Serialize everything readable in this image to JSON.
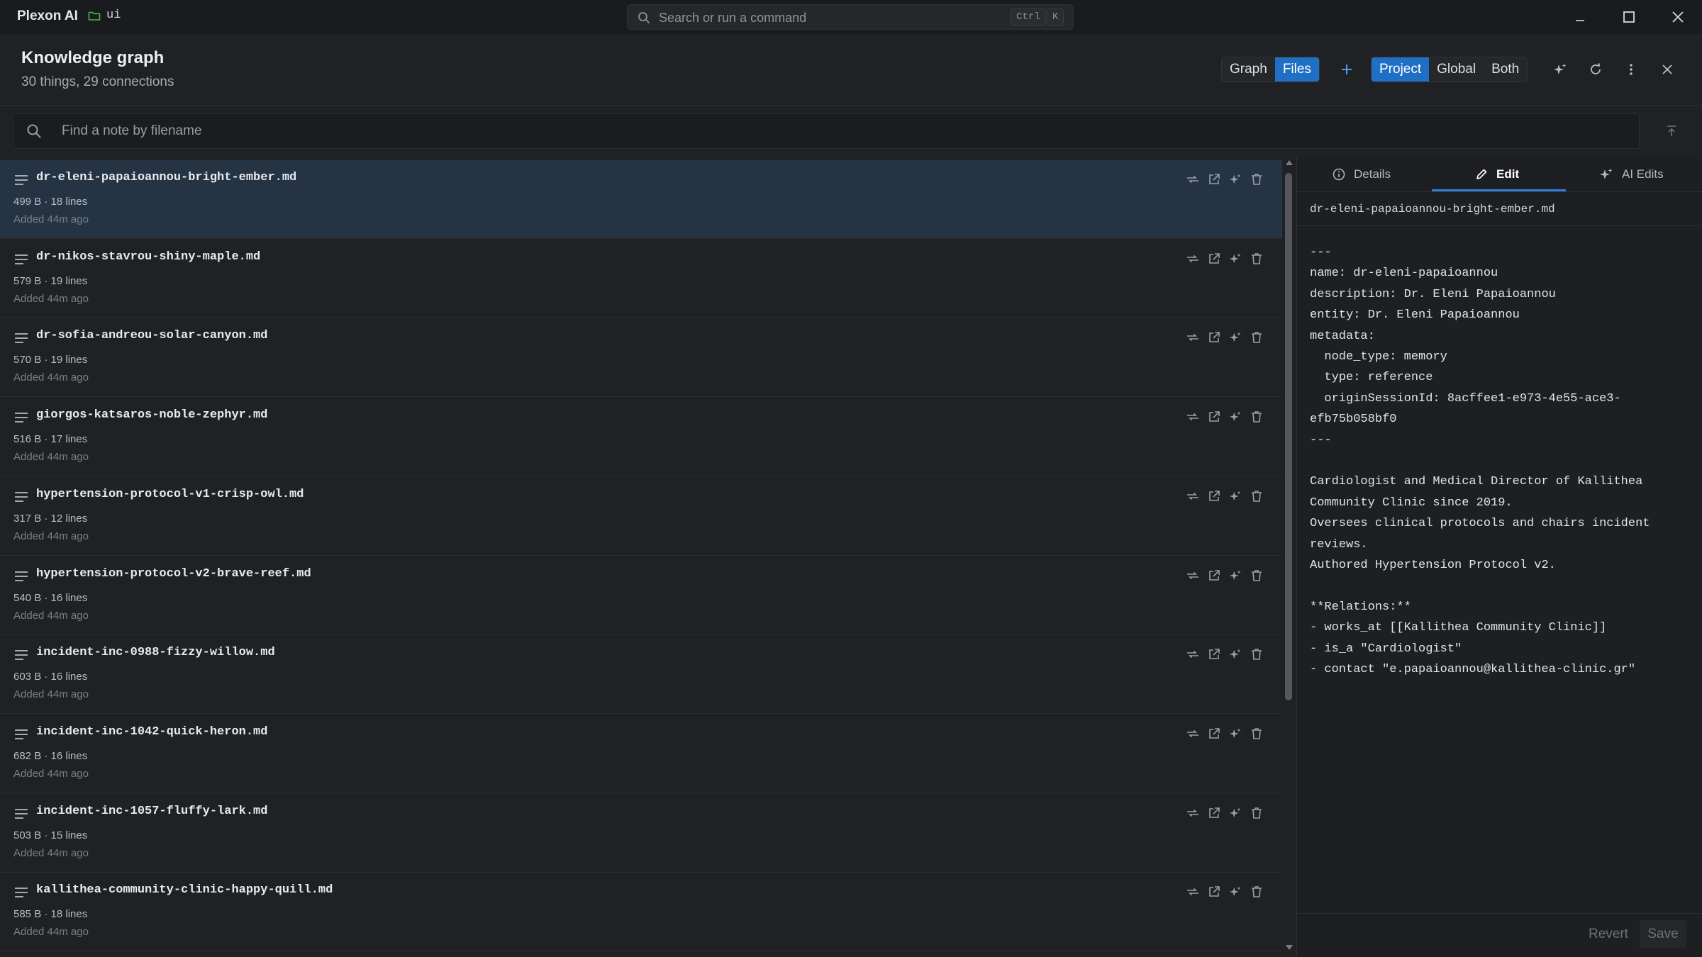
{
  "titlebar": {
    "app_name": "Plexon AI",
    "folder": "ui",
    "command_placeholder": "Search or run a command",
    "shortcut_ctrl": "Ctrl",
    "shortcut_key": "K"
  },
  "header": {
    "title": "Knowledge graph",
    "subtitle": "30 things, 29 connections",
    "view_toggle": [
      "Graph",
      "Files"
    ],
    "view_active": "Files",
    "scope_toggle": [
      "Project",
      "Global",
      "Both"
    ],
    "scope_active": "Project"
  },
  "search": {
    "placeholder": "Find a note by filename"
  },
  "files": [
    {
      "name": "dr-eleni-papaioannou-bright-ember.md",
      "meta": "499 B · 18 lines",
      "added": "Added 44m ago",
      "selected": true
    },
    {
      "name": "dr-nikos-stavrou-shiny-maple.md",
      "meta": "579 B · 19 lines",
      "added": "Added 44m ago"
    },
    {
      "name": "dr-sofia-andreou-solar-canyon.md",
      "meta": "570 B · 19 lines",
      "added": "Added 44m ago"
    },
    {
      "name": "giorgos-katsaros-noble-zephyr.md",
      "meta": "516 B · 17 lines",
      "added": "Added 44m ago"
    },
    {
      "name": "hypertension-protocol-v1-crisp-owl.md",
      "meta": "317 B · 12 lines",
      "added": "Added 44m ago"
    },
    {
      "name": "hypertension-protocol-v2-brave-reef.md",
      "meta": "540 B · 16 lines",
      "added": "Added 44m ago"
    },
    {
      "name": "incident-inc-0988-fizzy-willow.md",
      "meta": "603 B · 16 lines",
      "added": "Added 44m ago"
    },
    {
      "name": "incident-inc-1042-quick-heron.md",
      "meta": "682 B · 16 lines",
      "added": "Added 44m ago"
    },
    {
      "name": "incident-inc-1057-fluffy-lark.md",
      "meta": "503 B · 15 lines",
      "added": "Added 44m ago"
    },
    {
      "name": "kallithea-community-clinic-happy-quill.md",
      "meta": "585 B · 18 lines",
      "added": "Added 44m ago"
    }
  ],
  "panel": {
    "tabs": [
      "Details",
      "Edit",
      "AI Edits"
    ],
    "active_tab": "Edit",
    "filename": "dr-eleni-papaioannou-bright-ember.md",
    "content": "---\nname: dr-eleni-papaioannou\ndescription: Dr. Eleni Papaioannou\nentity: Dr. Eleni Papaioannou\nmetadata:\n  node_type: memory\n  type: reference\n  originSessionId: 8acffee1-e973-4e55-ace3-efb75b058bf0\n---\n\nCardiologist and Medical Director of Kallithea Community Clinic since 2019.\nOversees clinical protocols and chairs incident reviews.\nAuthored Hypertension Protocol v2.\n\n**Relations:**\n- works_at [[Kallithea Community Clinic]]\n- is_a \"Cardiologist\"\n- contact \"e.papaioannou@kallithea-clinic.gr\"",
    "revert_label": "Revert",
    "save_label": "Save"
  },
  "colors": {
    "accent": "#1f6fc4",
    "selected_row": "#253445",
    "background": "#202124"
  }
}
